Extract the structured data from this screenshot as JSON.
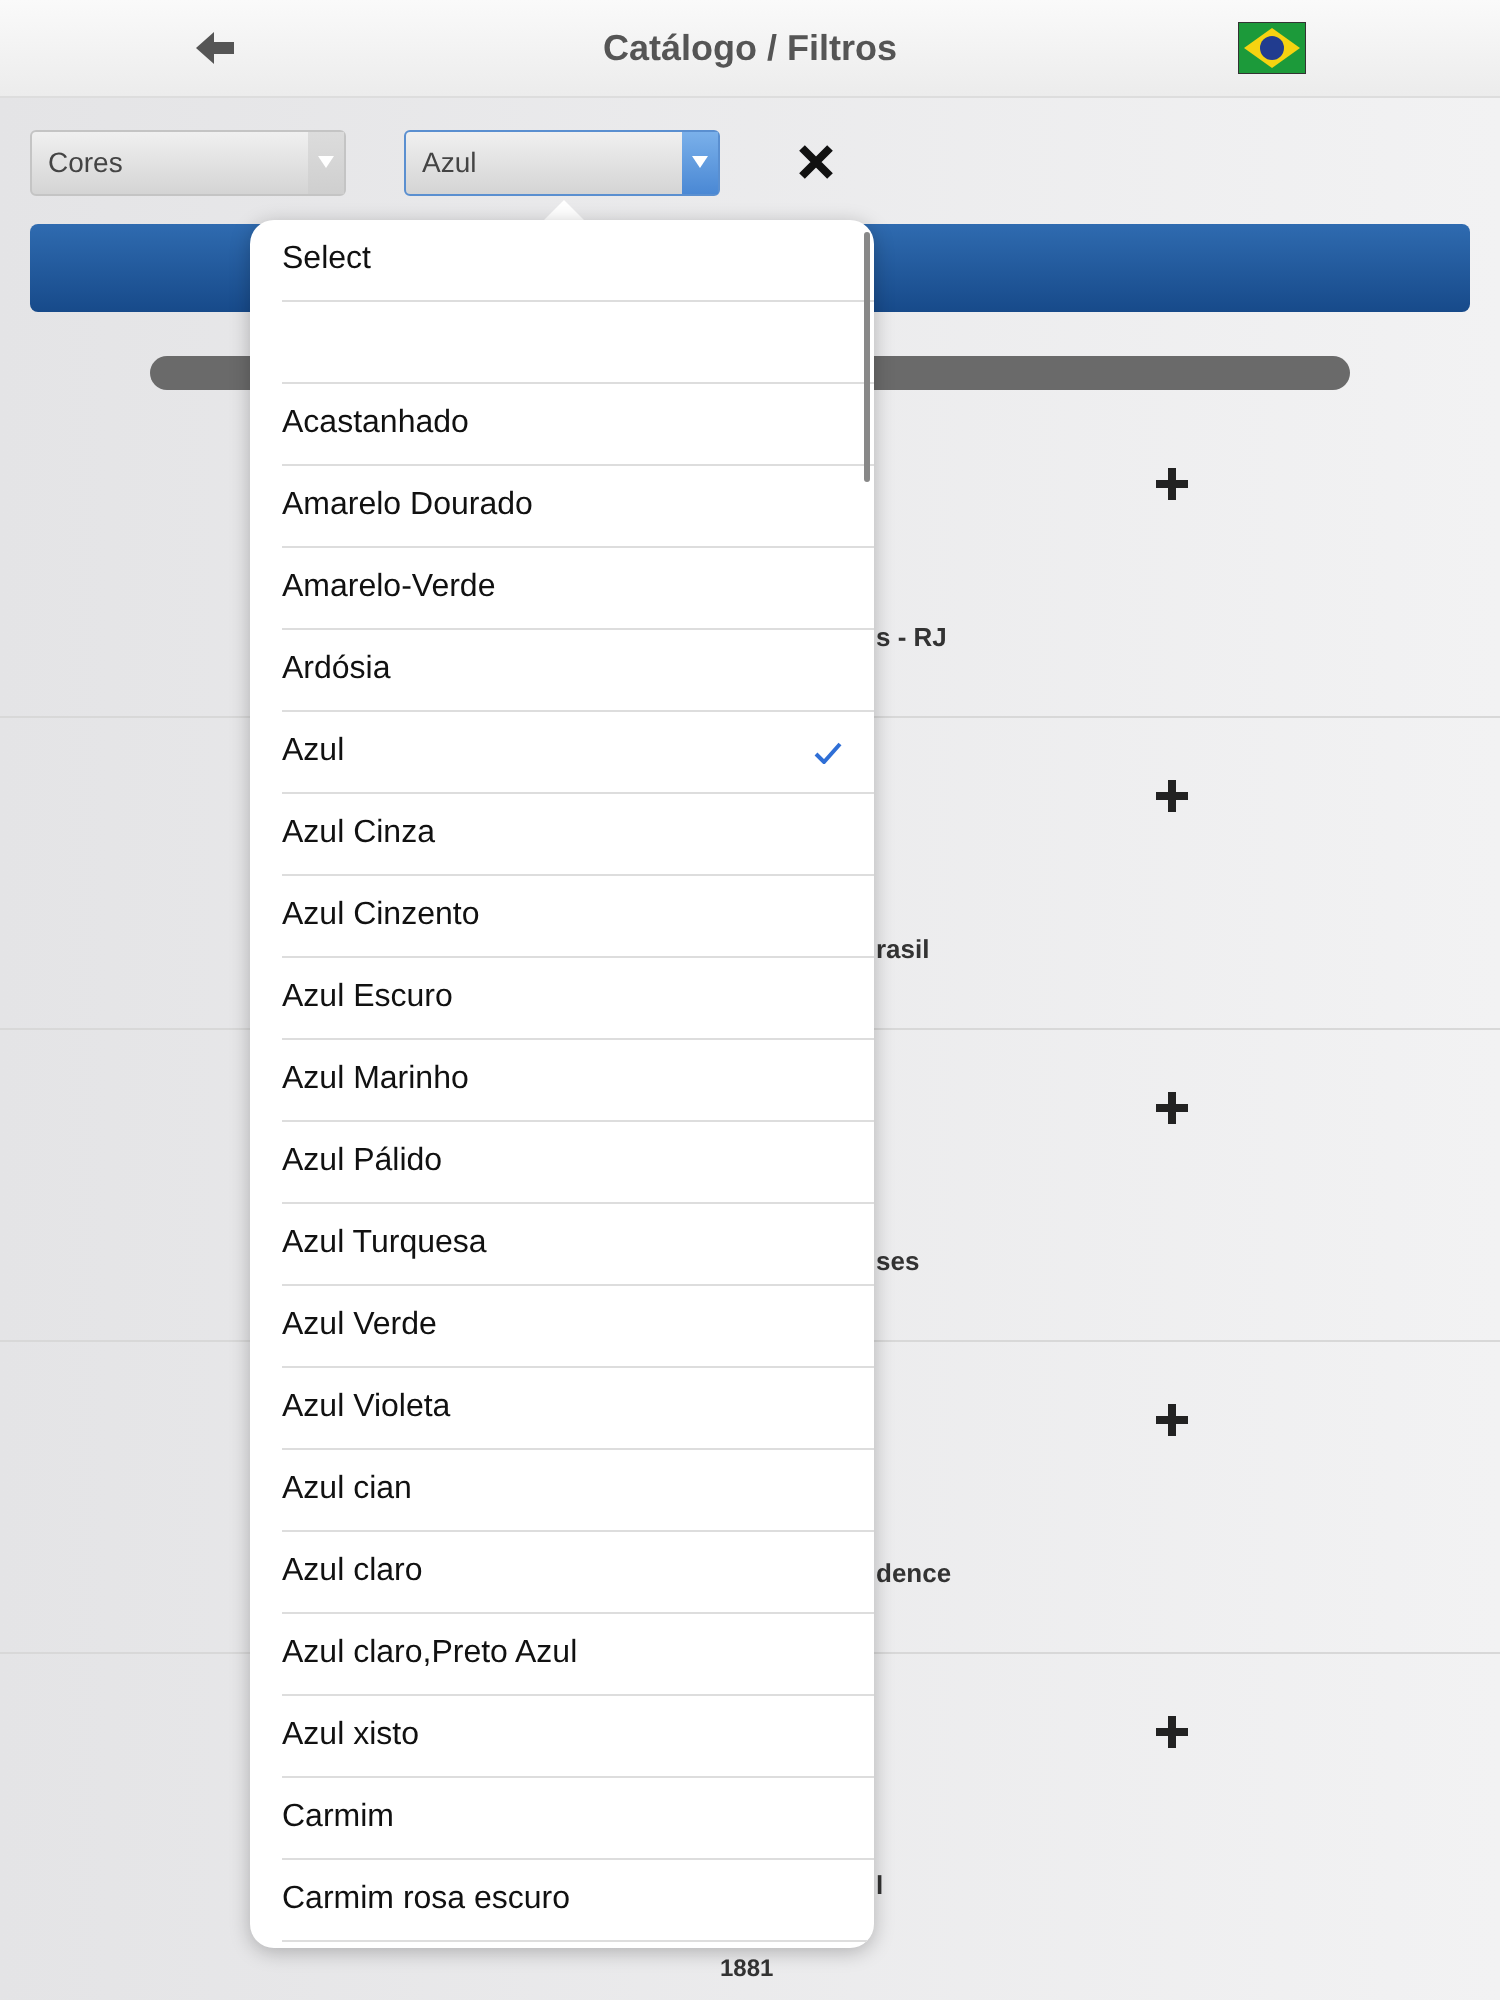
{
  "header": {
    "title": "Catálogo / Filtros"
  },
  "filters": [
    {
      "value": "Cores",
      "active": false
    },
    {
      "value": "Azul",
      "active": true
    }
  ],
  "catalog_rows": [
    {
      "text": "s - RJ"
    },
    {
      "text": "rasil"
    },
    {
      "text": "ses"
    },
    {
      "text": "dence"
    },
    {
      "text": "l",
      "sub": "1881"
    }
  ],
  "dropdown": {
    "items": [
      {
        "kind": "option",
        "label": "Select",
        "selected": false
      },
      {
        "kind": "blank",
        "selected": false
      },
      {
        "kind": "option",
        "label": "Acastanhado",
        "selected": false
      },
      {
        "kind": "option",
        "label": "Amarelo Dourado",
        "selected": false
      },
      {
        "kind": "option",
        "label": "Amarelo-Verde",
        "selected": false
      },
      {
        "kind": "option",
        "label": "Ardósia",
        "selected": false
      },
      {
        "kind": "option",
        "label": "Azul",
        "selected": true
      },
      {
        "kind": "option",
        "label": "Azul Cinza",
        "selected": false
      },
      {
        "kind": "option",
        "label": "Azul Cinzento",
        "selected": false
      },
      {
        "kind": "option",
        "label": "Azul Escuro",
        "selected": false
      },
      {
        "kind": "option",
        "label": "Azul Marinho",
        "selected": false
      },
      {
        "kind": "option",
        "label": "Azul Pálido",
        "selected": false
      },
      {
        "kind": "option",
        "label": "Azul Turquesa",
        "selected": false
      },
      {
        "kind": "option",
        "label": "Azul Verde",
        "selected": false
      },
      {
        "kind": "option",
        "label": "Azul Violeta",
        "selected": false
      },
      {
        "kind": "option",
        "label": "Azul cian",
        "selected": false
      },
      {
        "kind": "option",
        "label": "Azul claro",
        "selected": false
      },
      {
        "kind": "option",
        "label": "Azul claro,Preto Azul",
        "selected": false
      },
      {
        "kind": "option",
        "label": "Azul xisto",
        "selected": false
      },
      {
        "kind": "option",
        "label": "Carmim",
        "selected": false
      },
      {
        "kind": "option",
        "label": "Carmim rosa escuro",
        "selected": false
      }
    ]
  }
}
